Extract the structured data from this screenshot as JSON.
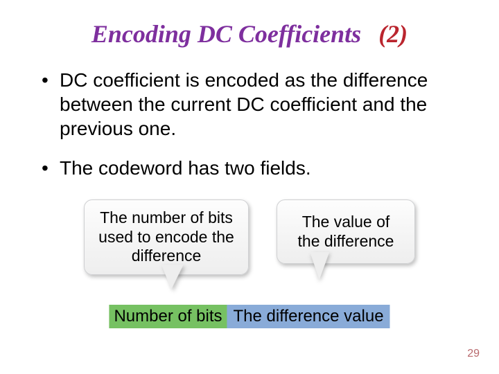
{
  "title": {
    "main": "Encoding DC Coefficients",
    "num": "(2)"
  },
  "bullets": [
    "DC coefficient is encoded as the difference between the current DC coefficient and the previous one.",
    "The codeword has two fields."
  ],
  "callouts": {
    "left": "The number of bits used to encode the difference",
    "right": "The value of the difference"
  },
  "fields": {
    "a": "Number of bits",
    "b": "The difference value"
  },
  "page": "29"
}
